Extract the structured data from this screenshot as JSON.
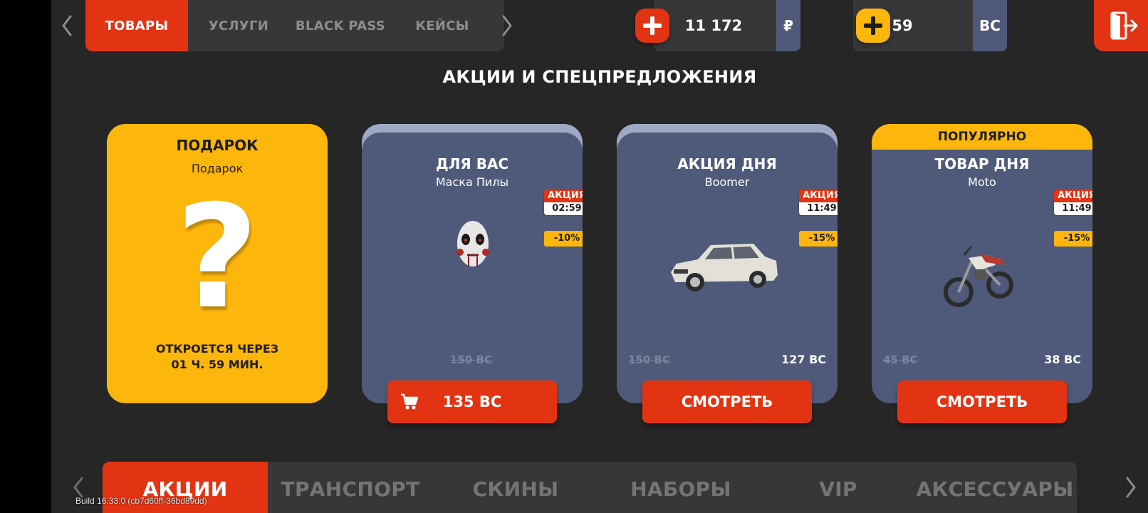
{
  "top_tabs": [
    "ТОВАРЫ",
    "УСЛУГИ",
    "BLACK PASS",
    "КЕЙСЫ"
  ],
  "currency": {
    "rub_amount": "11 172",
    "rub_symbol": "₽",
    "bc_amount": "59",
    "bc_symbol": "BC"
  },
  "section_title": "АКЦИИ И СПЕЦПРЕДЛОЖЕНИЯ",
  "cards": {
    "gift": {
      "title": "ПОДАРОК",
      "subtitle": "Подарок",
      "mark": "?",
      "opens_line1": "ОТКРОЕТСЯ ЧЕРЕЗ",
      "opens_line2": "01 Ч. 59 МИН."
    },
    "for_you": {
      "title": "ДЛЯ ВАС",
      "subtitle": "Маска Пилы",
      "promo_label": "АКЦИЯ",
      "promo_timer": "02:59",
      "discount": "-10%",
      "old_price": "150 BC",
      "button": "135 BC"
    },
    "deal_of_day": {
      "title": "АКЦИЯ ДНЯ",
      "subtitle": "Boomer",
      "promo_label": "АКЦИЯ",
      "promo_timer": "11:49",
      "discount": "-15%",
      "old_price": "150 BC",
      "new_price": "127 BC",
      "button": "СМОТРЕТЬ"
    },
    "item_of_day": {
      "ribbon": "ПОПУЛЯРНО",
      "title": "ТОВАР ДНЯ",
      "subtitle": "Moto",
      "promo_label": "АКЦИЯ",
      "promo_timer": "11:49",
      "discount": "-15%",
      "old_price": "45 BC",
      "new_price": "38 BC",
      "button": "СМОТРЕТЬ"
    }
  },
  "categories": [
    "АКЦИИ",
    "ТРАНСПОРТ",
    "СКИНЫ",
    "НАБОРЫ",
    "VIP",
    "АКСЕССУАРЫ"
  ],
  "build": "Build 16.33.0 (cb7d60ff-36bd89dd)",
  "colors": {
    "accent_red": "#e23413",
    "gold": "#fdb60c",
    "card_blue": "#4f5a7a",
    "background": "#262626"
  },
  "icons": [
    "chevron-left-icon",
    "chevron-right-icon",
    "plus-icon",
    "exit-door-icon",
    "cart-icon"
  ]
}
